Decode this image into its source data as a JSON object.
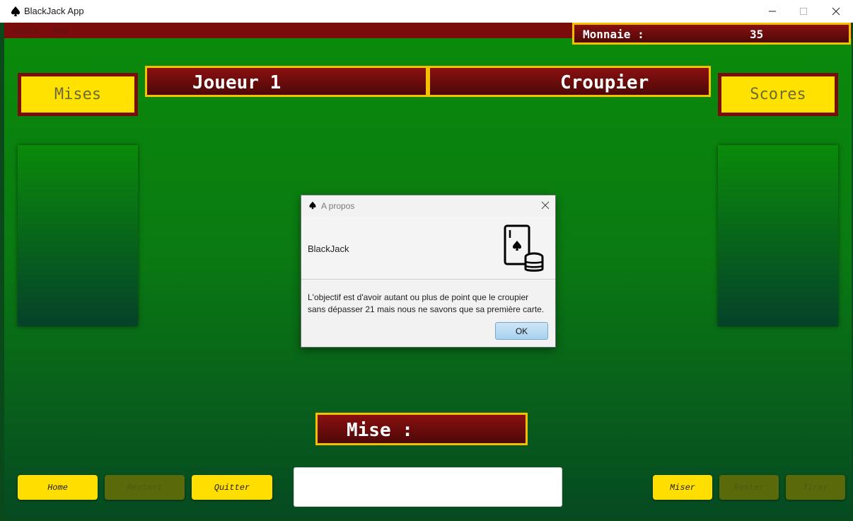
{
  "window": {
    "title": "BlackJack App",
    "icon": "spade-icon",
    "controls": [
      "minimize-icon",
      "maximize-icon",
      "close-icon"
    ]
  },
  "menu": {
    "items": [
      "Action",
      "Aide"
    ]
  },
  "money": {
    "label": "Monnaie :",
    "value": "35"
  },
  "headers": {
    "player": "Joueur 1",
    "dealer": "Croupier"
  },
  "side_buttons": {
    "bets": "Mises",
    "scores": "Scores"
  },
  "bet_label": "Mise :",
  "bottom_buttons": {
    "home": {
      "label": "Home",
      "enabled": true
    },
    "restart": {
      "label": "Restart",
      "enabled": false
    },
    "quit": {
      "label": "Quitter",
      "enabled": true
    },
    "bet": {
      "label": "Miser",
      "enabled": true
    },
    "stand": {
      "label": "Rester",
      "enabled": false
    },
    "hit": {
      "label": "Tirer",
      "enabled": false
    }
  },
  "bet_input": {
    "value": ""
  },
  "dialog": {
    "title": "A propos",
    "app_name": "BlackJack",
    "message": "L'objectif est d'avoir autant ou plus de point que le croupier sans dépasser 21 mais nous ne savons que sa première carte.",
    "ok_label": "OK",
    "icon": "card-and-chips-icon"
  },
  "colors": {
    "felt": "#0a7a12",
    "maroon": "#7a0c0c",
    "gold": "#f5c000",
    "yellow": "#ffe200"
  }
}
